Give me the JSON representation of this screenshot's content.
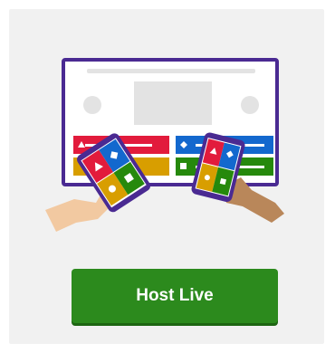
{
  "card": {
    "button_label": "Host Live"
  },
  "illustration": {
    "icon": "host-screen-with-phones-icon",
    "colors": {
      "frame": "#4a2a92",
      "red": "#e21b3c",
      "blue": "#1368ce",
      "yellow": "#d89e00",
      "green": "#26890c",
      "placeholder": "#e3e3e3",
      "skin_light": "#f2c9a1",
      "skin_dark": "#b9875a"
    }
  },
  "button": {
    "color": "#2c8a1d"
  }
}
